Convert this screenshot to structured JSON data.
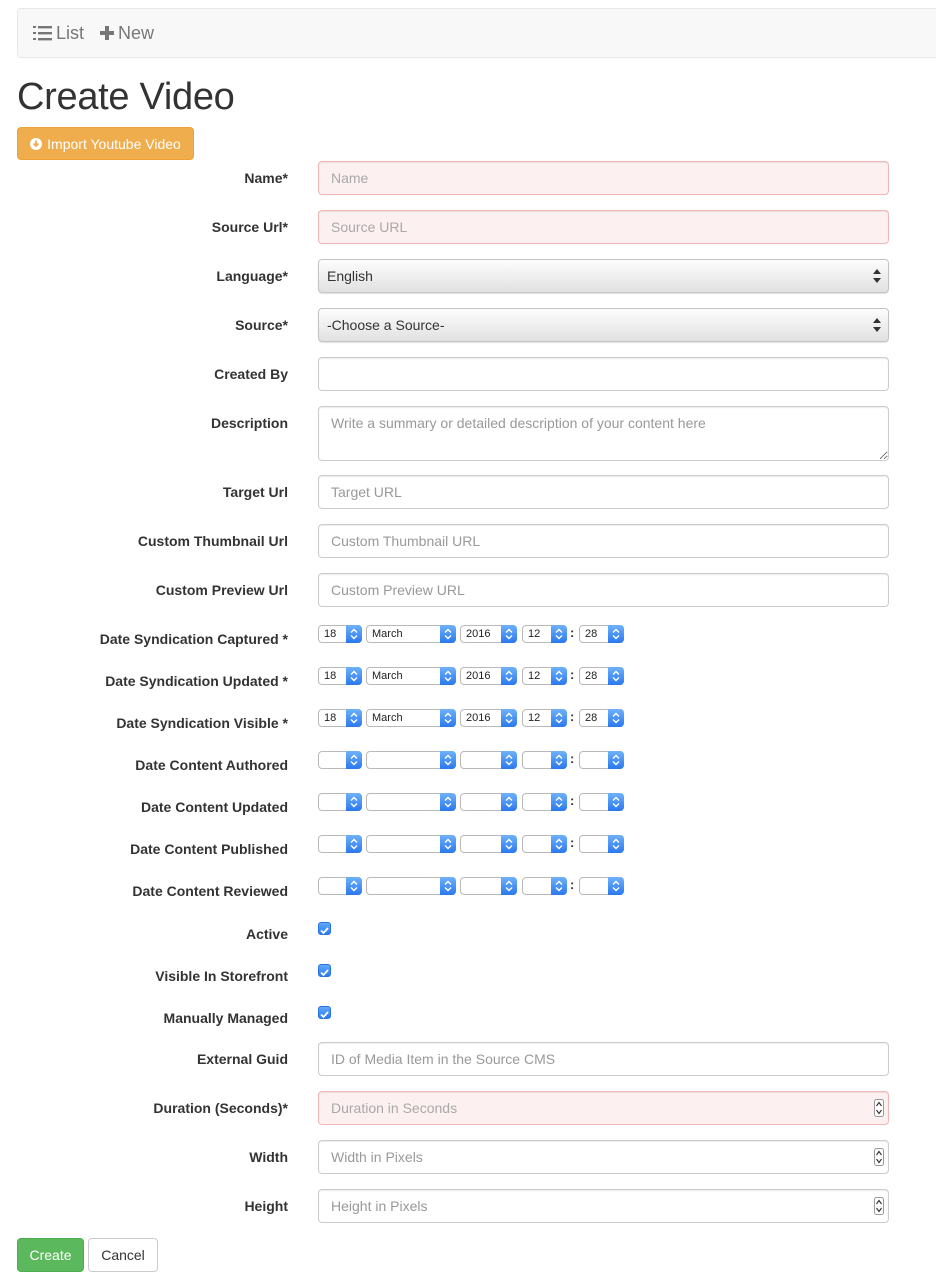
{
  "nav": {
    "list_label": "List",
    "new_label": "New"
  },
  "page_title": "Create Video",
  "import_button": "Import Youtube Video",
  "fields": {
    "name": {
      "label": "Name*",
      "placeholder": "Name"
    },
    "source_url": {
      "label": "Source Url*",
      "placeholder": "Source URL"
    },
    "language": {
      "label": "Language*",
      "value": "English"
    },
    "source": {
      "label": "Source*",
      "value": "-Choose a Source-"
    },
    "created_by": {
      "label": "Created By",
      "value": ""
    },
    "description": {
      "label": "Description",
      "placeholder": "Write a summary or detailed description of your content here"
    },
    "target_url": {
      "label": "Target Url",
      "placeholder": "Target URL"
    },
    "custom_thumbnail_url": {
      "label": "Custom Thumbnail Url",
      "placeholder": "Custom Thumbnail URL"
    },
    "custom_preview_url": {
      "label": "Custom Preview Url",
      "placeholder": "Custom Preview URL"
    },
    "external_guid": {
      "label": "External Guid",
      "placeholder": "ID of Media Item in the Source CMS"
    },
    "duration": {
      "label": "Duration (Seconds)*",
      "placeholder": "Duration in Seconds"
    },
    "width": {
      "label": "Width",
      "placeholder": "Width in Pixels"
    },
    "height": {
      "label": "Height",
      "placeholder": "Height in Pixels"
    }
  },
  "dates": [
    {
      "label": "Date Syndication Captured *",
      "day": "18",
      "month": "March",
      "year": "2016",
      "hour": "12",
      "minute": "28"
    },
    {
      "label": "Date Syndication Updated *",
      "day": "18",
      "month": "March",
      "year": "2016",
      "hour": "12",
      "minute": "28"
    },
    {
      "label": "Date Syndication Visible *",
      "day": "18",
      "month": "March",
      "year": "2016",
      "hour": "12",
      "minute": "28"
    },
    {
      "label": "Date Content Authored",
      "day": "",
      "month": "",
      "year": "",
      "hour": "",
      "minute": ""
    },
    {
      "label": "Date Content Updated",
      "day": "",
      "month": "",
      "year": "",
      "hour": "",
      "minute": ""
    },
    {
      "label": "Date Content Published",
      "day": "",
      "month": "",
      "year": "",
      "hour": "",
      "minute": ""
    },
    {
      "label": "Date Content Reviewed",
      "day": "",
      "month": "",
      "year": "",
      "hour": "",
      "minute": ""
    }
  ],
  "date_separator": ":",
  "checkboxes": [
    {
      "label": "Active",
      "checked": true
    },
    {
      "label": "Visible In Storefront",
      "checked": true
    },
    {
      "label": "Manually Managed",
      "checked": true
    }
  ],
  "buttons": {
    "create": "Create",
    "cancel": "Cancel"
  },
  "colors": {
    "primary_warning": "#f0ad4e",
    "success": "#5cb85c",
    "error_border": "#f1b6b6",
    "error_bg": "#fdf0f0",
    "mac_select_blue": "#2a78ee"
  }
}
